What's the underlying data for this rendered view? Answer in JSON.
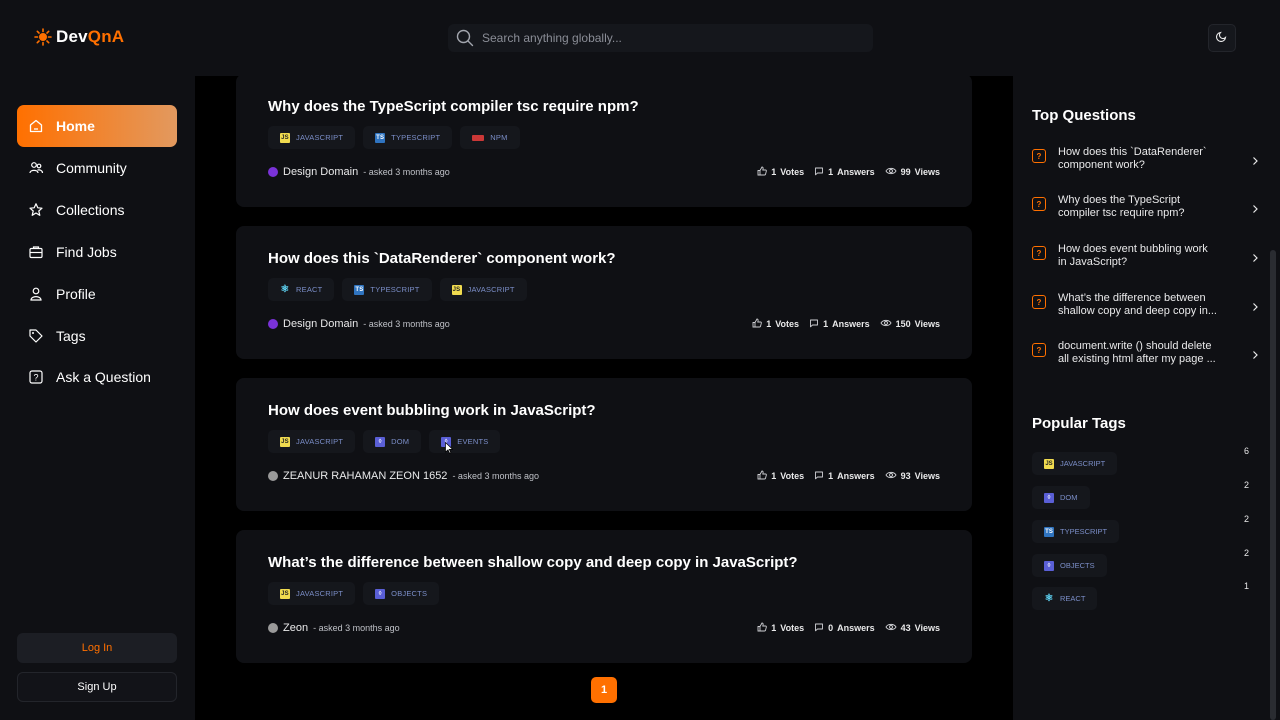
{
  "app": {
    "logo_prefix": "Dev",
    "logo_accent": "QnA",
    "accent_color": "#ff7000"
  },
  "search": {
    "placeholder": "Search anything globally..."
  },
  "sidebar": {
    "items": [
      {
        "label": "Home",
        "icon": "home-icon",
        "active": true
      },
      {
        "label": "Community",
        "icon": "users-icon"
      },
      {
        "label": "Collections",
        "icon": "star-icon"
      },
      {
        "label": "Find Jobs",
        "icon": "briefcase-icon"
      },
      {
        "label": "Profile",
        "icon": "user-icon"
      },
      {
        "label": "Tags",
        "icon": "tag-icon"
      },
      {
        "label": "Ask a Question",
        "icon": "question-icon"
      }
    ],
    "login_label": "Log In",
    "signup_label": "Sign Up"
  },
  "questions": [
    {
      "title": "Why does the TypeScript compiler tsc require npm?",
      "tags": [
        "JAVASCRIPT",
        "TYPESCRIPT",
        "NPM"
      ],
      "author": "Design Domain",
      "asked": "- asked 3 months ago",
      "votes": "1",
      "votes_label": "Votes",
      "answers": "1",
      "answers_label": "Answers",
      "views": "99",
      "views_label": "Views"
    },
    {
      "title": "How does this `DataRenderer` component work?",
      "tags": [
        "REACT",
        "TYPESCRIPT",
        "JAVASCRIPT"
      ],
      "author": "Design Domain",
      "asked": "- asked 3 months ago",
      "votes": "1",
      "votes_label": "Votes",
      "answers": "1",
      "answers_label": "Answers",
      "views": "150",
      "views_label": "Views"
    },
    {
      "title": "How does event bubbling work in JavaScript?",
      "tags": [
        "JAVASCRIPT",
        "DOM",
        "EVENTS"
      ],
      "author": "ZEANUR RAHAMAN ZEON 1652",
      "asked": "- asked 3 months ago",
      "votes": "1",
      "votes_label": "Votes",
      "answers": "1",
      "answers_label": "Answers",
      "views": "93",
      "views_label": "Views"
    },
    {
      "title": "What’s the difference between shallow copy and deep copy in JavaScript?",
      "tags": [
        "JAVASCRIPT",
        "OBJECTS"
      ],
      "author": "Zeon",
      "asked": "- asked 3 months ago",
      "votes": "1",
      "votes_label": "Votes",
      "answers": "0",
      "answers_label": "Answers",
      "views": "43",
      "views_label": "Views"
    }
  ],
  "pagination": {
    "current": "1"
  },
  "top_questions": {
    "heading": "Top Questions",
    "items": [
      {
        "line1": "How does this `DataRenderer`",
        "line2": "component work?"
      },
      {
        "line1": "Why does the TypeScript",
        "line2": "compiler tsc require npm?"
      },
      {
        "line1": "How does event bubbling work",
        "line2": "in JavaScript?"
      },
      {
        "line1": "What’s the difference between",
        "line2": "shallow copy and deep copy in..."
      },
      {
        "line1": "document.write () should delete",
        "line2": "all existing html after my page ..."
      }
    ]
  },
  "popular_tags": {
    "heading": "Popular Tags",
    "items": [
      {
        "name": "JAVASCRIPT",
        "count": "6"
      },
      {
        "name": "DOM",
        "count": "2"
      },
      {
        "name": "TYPESCRIPT",
        "count": "2"
      },
      {
        "name": "OBJECTS",
        "count": "2"
      },
      {
        "name": "REACT",
        "count": "1"
      }
    ]
  }
}
